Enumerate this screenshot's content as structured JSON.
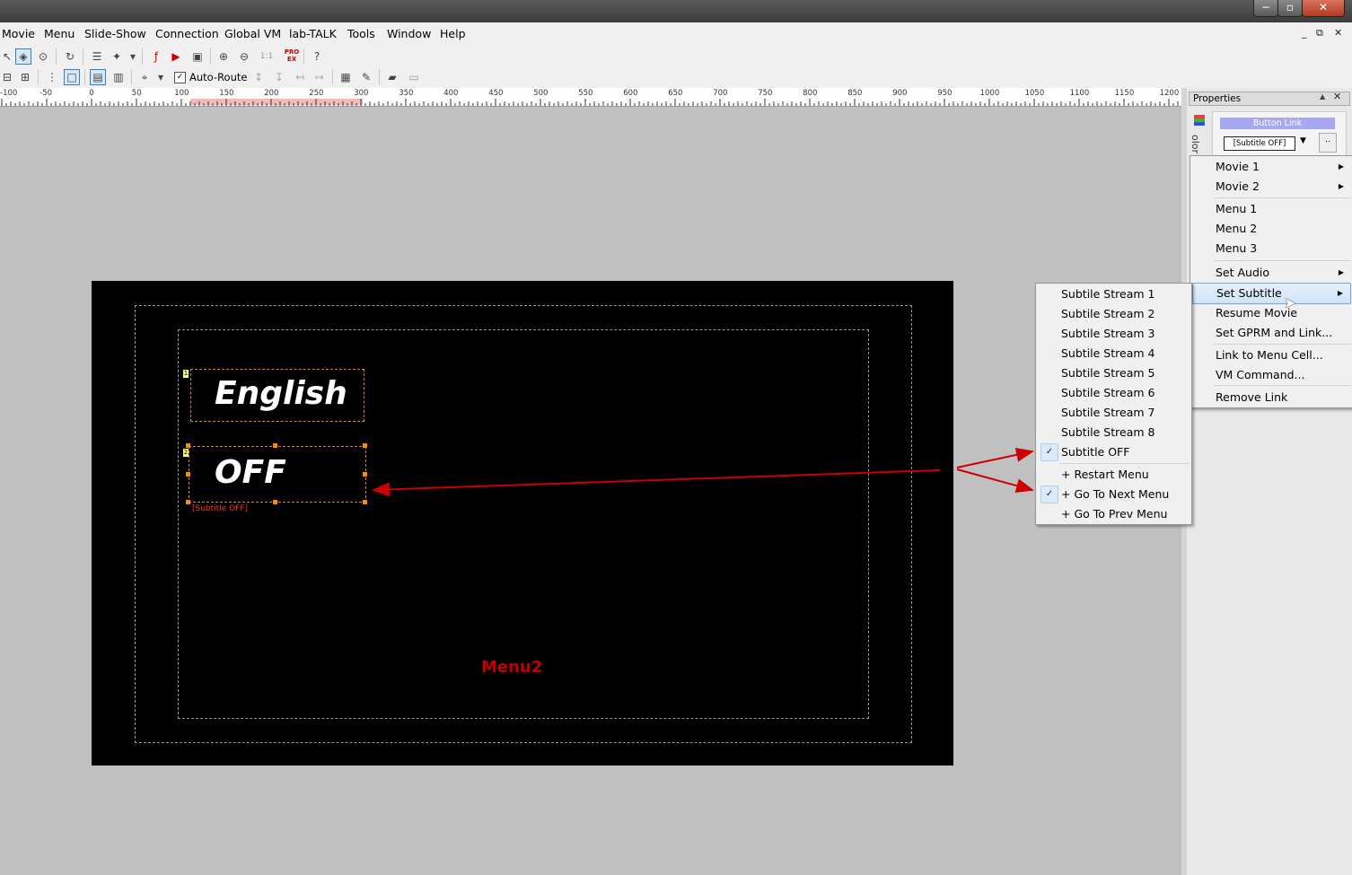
{
  "menubar": {
    "items": [
      "Movie",
      "Menu",
      "Slide-Show",
      "Connection",
      "Global VM",
      "lab-TALK",
      "Tools",
      "Window",
      "Help"
    ],
    "mdi_min": "_",
    "mdi_restore": "⧉",
    "mdi_close": "✕"
  },
  "window": {
    "min": "−",
    "max": "▫",
    "close": "✕"
  },
  "toolbar": {
    "autoroute_label": "Auto-Route",
    "autoroute_checked": "✓",
    "one_to_one": "1:1",
    "pro_ex": "PRO EX"
  },
  "ruler": {
    "labels": [
      "-100",
      "-50",
      "0",
      "50",
      "100",
      "150",
      "200",
      "250",
      "300",
      "350",
      "400",
      "450",
      "500",
      "550",
      "600",
      "650",
      "700",
      "750",
      "800",
      "850",
      "900",
      "950",
      "1000",
      "1050",
      "1100",
      "1150",
      "1200"
    ]
  },
  "canvas": {
    "buttons": [
      {
        "index": "1",
        "text": "English"
      },
      {
        "index": "2",
        "text": "OFF"
      }
    ],
    "link_label": "[Subtitle OFF]",
    "caption": "Menu2"
  },
  "properties": {
    "title": "Properties",
    "button_link_title": "Button Link",
    "button_link_value": "[Subtitle OFF]",
    "dots": "..",
    "vertical_text": "olor",
    "colors": {
      "button_link_header": "#a8a8f0",
      "arrow": "#cc0000",
      "caption": "#c00000"
    }
  },
  "main_menu": {
    "items": [
      {
        "label": "Movie 1",
        "submenu": "▶"
      },
      {
        "label": "Movie 2",
        "submenu": "▶"
      },
      {
        "label": "Menu 1"
      },
      {
        "label": "Menu 2"
      },
      {
        "label": "Menu 3"
      },
      {
        "label": "Set Audio",
        "submenu": "▶"
      },
      {
        "label": "Set Subtitle",
        "submenu": "▶",
        "highlighted": true
      },
      {
        "label": "Resume Movie"
      },
      {
        "label": "Set GPRM and Link..."
      },
      {
        "label": "Link to Menu Cell..."
      },
      {
        "label": "VM Command..."
      },
      {
        "label": "Remove Link"
      }
    ]
  },
  "sub_menu": {
    "items": [
      {
        "label": "Subtile Stream 1"
      },
      {
        "label": "Subtile Stream 2"
      },
      {
        "label": "Subtile Stream 3"
      },
      {
        "label": "Subtile Stream 4"
      },
      {
        "label": "Subtile Stream 5"
      },
      {
        "label": "Subtile Stream 6"
      },
      {
        "label": "Subtile Stream 7"
      },
      {
        "label": "Subtile Stream 8"
      },
      {
        "label": "Subtitle OFF",
        "checked": "✓"
      },
      {
        "label": "+ Restart Menu"
      },
      {
        "label": "+ Go To Next Menu",
        "checked": "✓"
      },
      {
        "label": "+ Go To Prev Menu"
      }
    ]
  }
}
